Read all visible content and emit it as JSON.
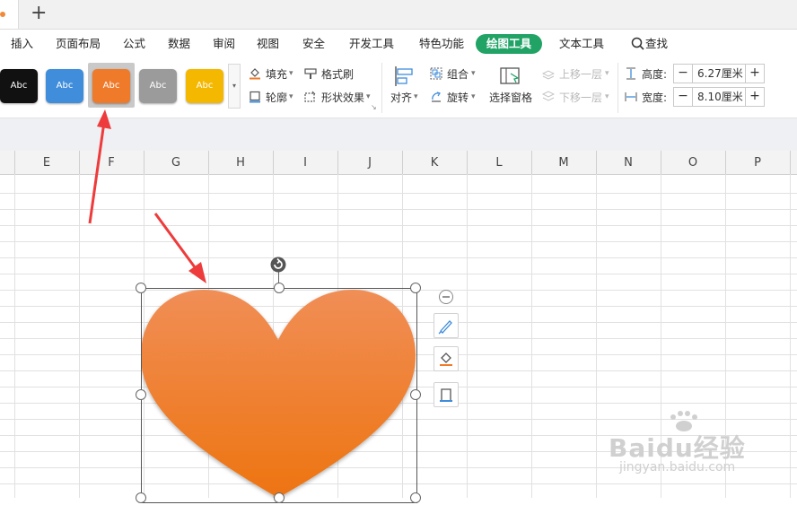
{
  "tabbar": {
    "new_tab": "+"
  },
  "menu": {
    "items": [
      "插入",
      "页面布局",
      "公式",
      "数据",
      "审阅",
      "视图",
      "安全",
      "开发工具",
      "特色功能"
    ],
    "active": "绘图工具",
    "after": "文本工具",
    "search": "查找"
  },
  "ribbon": {
    "styles": [
      {
        "label": "Abc",
        "color": "#111111"
      },
      {
        "label": "Abc",
        "color": "#3f8ddb"
      },
      {
        "label": "Abc",
        "color": "#ef7b2a"
      },
      {
        "label": "Abc",
        "color": "#9b9b9b"
      },
      {
        "label": "Abc",
        "color": "#f5b800"
      }
    ],
    "fill": "填充",
    "format_painter": "格式刷",
    "outline": "轮廓",
    "shape_effects": "形状效果",
    "align": "对齐",
    "group": "组合",
    "rotate": "旋转",
    "selection_pane": "选择窗格",
    "bring_forward": "上移一层",
    "send_backward": "下移一层",
    "height_label": "高度:",
    "height_value": "6.27厘米",
    "width_label": "宽度:",
    "width_value": "8.10厘米"
  },
  "columns": [
    "E",
    "F",
    "G",
    "H",
    "I",
    "J",
    "K",
    "L",
    "M",
    "N",
    "O",
    "P"
  ],
  "shape": {
    "fill_top": "#f08e56",
    "fill_bottom": "#ee7410"
  },
  "watermark": {
    "text": "Baidu经验",
    "url": "jingyan.baidu.com"
  },
  "colors": {
    "accent": "#21a366",
    "arrow": "#ee3b3b"
  }
}
